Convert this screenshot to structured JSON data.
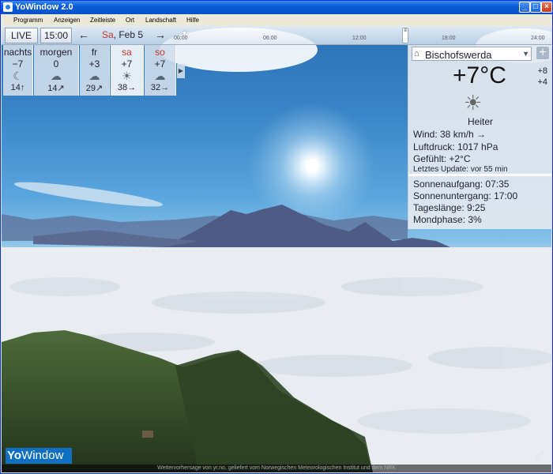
{
  "window": {
    "title": "YoWindow 2.0"
  },
  "menu": [
    "Programm",
    "Anzeigen",
    "Zeitleiste",
    "Ort",
    "Landschaft",
    "Hilfe"
  ],
  "timeline": {
    "live_label": "LIVE",
    "time": "15:00",
    "date_day": "Sa",
    "date_rest": ", Feb 5",
    "ticks": [
      "00:00",
      "06:00",
      "12:00",
      "18:00",
      "24:00"
    ]
  },
  "forecast": [
    {
      "name": "nachts",
      "temp": "−7",
      "icon": "moon-cloud-icon",
      "glyph": "☾",
      "wind": "14↑",
      "selected": false,
      "weekend": false
    },
    {
      "name": "morgen",
      "temp": "0",
      "icon": "snow-cloud-icon",
      "glyph": "☁",
      "wind": "14↗",
      "selected": false,
      "weekend": false
    },
    {
      "name": "fr",
      "temp": "+3",
      "icon": "cloud-icon",
      "glyph": "☁",
      "wind": "29↗",
      "selected": false,
      "weekend": false
    },
    {
      "name": "sa",
      "temp": "+7",
      "icon": "sun-cloud-icon",
      "glyph": "☀",
      "wind": "38→",
      "selected": true,
      "weekend": true
    },
    {
      "name": "so",
      "temp": "+7",
      "icon": "rain-cloud-icon",
      "glyph": "☁",
      "wind": "32→",
      "selected": false,
      "weekend": true
    }
  ],
  "panel": {
    "city": "Bischofswerda",
    "temp": "+7°C",
    "high": "+8",
    "low": "+4",
    "condition": "Heiter",
    "wind": "Wind:  38 km/h →",
    "pressure": "Luftdruck:  1017 hPa",
    "feels": "Gefühlt:  +2°C",
    "updated": "Letztes Update:  vor 55 min",
    "sunrise": "Sonnenaufgang:  07:35",
    "sunset": "Sonnenuntergang:  17:00",
    "daylength": "Tageslänge:  9:25",
    "moonphase": "Mondphase:  3%"
  },
  "brand": {
    "yo": "Yo",
    "window": "Window"
  },
  "credits": "Wettervorhersage von yr.no, geliefert vom Norwegischen Meteorologischen Institut und dem NRK",
  "colors": {
    "accent": "#0f6fc2",
    "weekend": "#c0392b",
    "titlebar": "#0a5cd8"
  }
}
